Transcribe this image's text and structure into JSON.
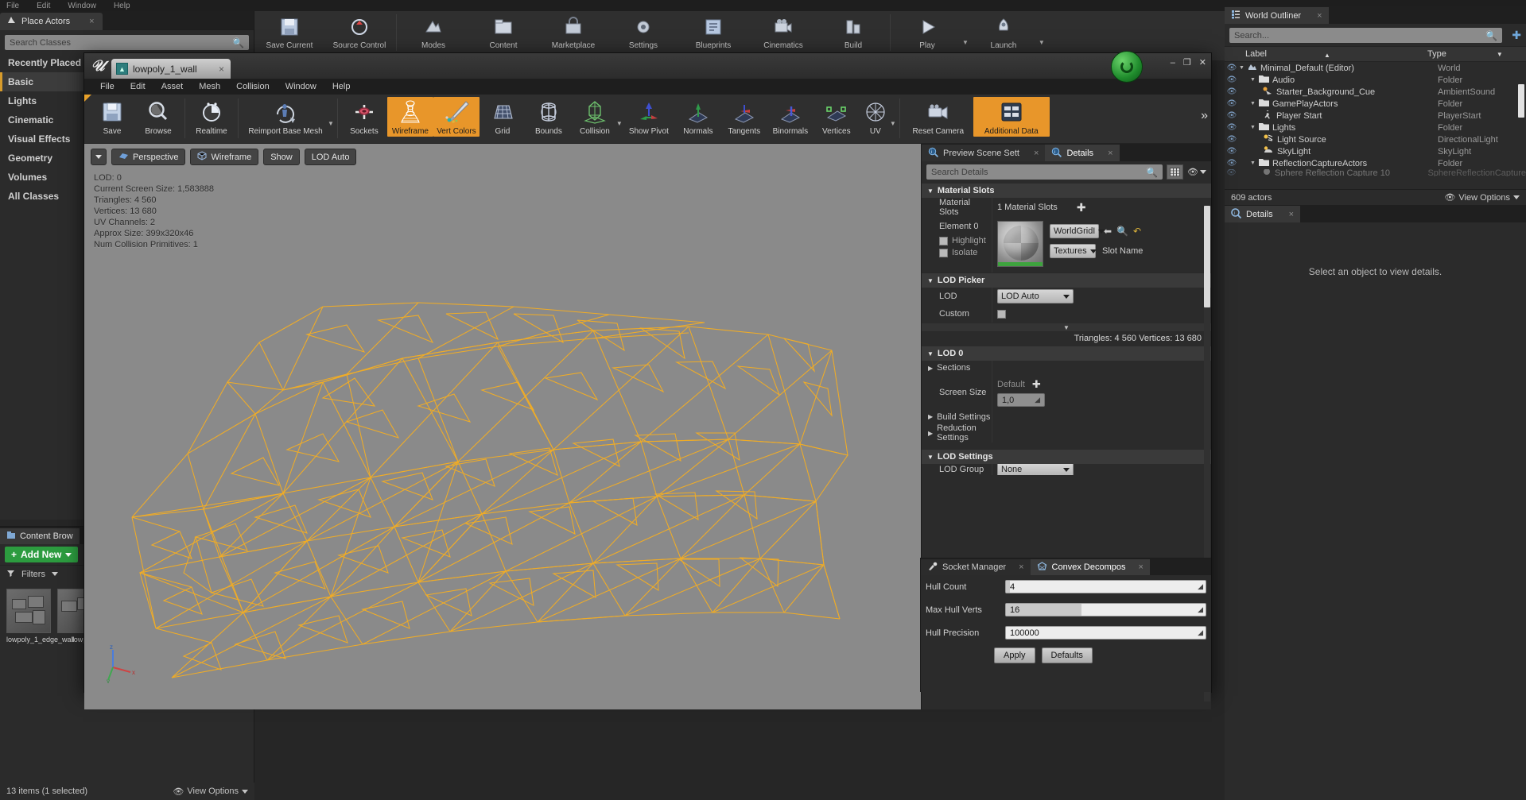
{
  "app": {
    "menubar": [
      "File",
      "Edit",
      "Window",
      "Help"
    ]
  },
  "place_actors": {
    "tab_label": "Place Actors",
    "tab_close": "×",
    "search_placeholder": "Search Classes",
    "categories": [
      {
        "label": "Recently Placed",
        "selected": false
      },
      {
        "label": "Basic",
        "selected": true
      },
      {
        "label": "Lights",
        "selected": false
      },
      {
        "label": "Cinematic",
        "selected": false
      },
      {
        "label": "Visual Effects",
        "selected": false
      },
      {
        "label": "Geometry",
        "selected": false
      },
      {
        "label": "Volumes",
        "selected": false
      },
      {
        "label": "All Classes",
        "selected": false
      }
    ]
  },
  "content_browser": {
    "tab_label": "Content Brow",
    "add_new_label": "Add New",
    "filters_label": "Filters",
    "assets": [
      {
        "name": "lowpoly_1_edge_wall"
      },
      {
        "name": "lowp"
      }
    ],
    "status": "13 items (1 selected)",
    "view_options": "View Options"
  },
  "main_toolbar": {
    "items": [
      {
        "label": "Save Current",
        "icon": "save-icon"
      },
      {
        "label": "Source Control",
        "icon": "source-control-icon"
      },
      {
        "label": "Modes",
        "icon": "modes-icon"
      },
      {
        "label": "Content",
        "icon": "content-icon"
      },
      {
        "label": "Marketplace",
        "icon": "marketplace-icon"
      },
      {
        "label": "Settings",
        "icon": "settings-icon"
      },
      {
        "label": "Blueprints",
        "icon": "blueprints-icon"
      },
      {
        "label": "Cinematics",
        "icon": "cinematics-icon"
      },
      {
        "label": "Build",
        "icon": "build-icon"
      },
      {
        "label": "Play",
        "icon": "play-icon"
      },
      {
        "label": "Launch",
        "icon": "launch-icon"
      }
    ]
  },
  "world_outliner": {
    "tab_label": "World Outliner",
    "tab_close": "×",
    "search_placeholder": "Search...",
    "columns": {
      "label": "Label",
      "type": "Type"
    },
    "rows": [
      {
        "label": "Minimal_Default (Editor)",
        "type": "World",
        "depth": 0,
        "expandable": true,
        "icon": "world-icon"
      },
      {
        "label": "Audio",
        "type": "Folder",
        "depth": 1,
        "expandable": true,
        "icon": "folder-icon"
      },
      {
        "label": "Starter_Background_Cue",
        "type": "AmbientSound",
        "depth": 2,
        "expandable": false,
        "icon": "ambient-sound-icon"
      },
      {
        "label": "GamePlayActors",
        "type": "Folder",
        "depth": 1,
        "expandable": true,
        "icon": "folder-icon"
      },
      {
        "label": "Player Start",
        "type": "PlayerStart",
        "depth": 2,
        "expandable": false,
        "icon": "player-start-icon"
      },
      {
        "label": "Lights",
        "type": "Folder",
        "depth": 1,
        "expandable": true,
        "icon": "folder-icon"
      },
      {
        "label": "Light Source",
        "type": "DirectionalLight",
        "depth": 2,
        "expandable": false,
        "icon": "directional-light-icon"
      },
      {
        "label": "SkyLight",
        "type": "SkyLight",
        "depth": 2,
        "expandable": false,
        "icon": "sky-light-icon"
      },
      {
        "label": "ReflectionCaptureActors",
        "type": "Folder",
        "depth": 1,
        "expandable": true,
        "icon": "folder-icon"
      },
      {
        "label": "Sphere Reflection Capture 10",
        "type": "SphereReflectionCapture",
        "depth": 2,
        "expandable": false,
        "icon": "reflection-capture-icon"
      }
    ],
    "actor_count": "609 actors",
    "view_options": "View Options"
  },
  "details_right": {
    "tab_label": "Details",
    "tab_close": "×",
    "empty_message": "Select an object to view details."
  },
  "mesh_window": {
    "title_tab": "lowpoly_1_wall",
    "tab_close": "×",
    "window_buttons": {
      "minimize": "–",
      "maximize": "❐",
      "close": "✕"
    },
    "menubar": [
      "File",
      "Edit",
      "Asset",
      "Mesh",
      "Collision",
      "Window",
      "Help"
    ],
    "toolbar": [
      {
        "label": "Save",
        "icon": "save-icon",
        "highlighted": false,
        "caret": false
      },
      {
        "label": "Browse",
        "icon": "browse-icon",
        "highlighted": false,
        "caret": false
      },
      {
        "label": "Realtime",
        "icon": "realtime-icon",
        "highlighted": false,
        "caret": false
      },
      {
        "label": "Reimport Base Mesh",
        "icon": "reimport-icon",
        "highlighted": false,
        "caret": true
      },
      {
        "label": "Sockets",
        "icon": "sockets-icon",
        "highlighted": false,
        "caret": false
      },
      {
        "label": "Wireframe",
        "icon": "wireframe-icon",
        "highlighted": true,
        "caret": false
      },
      {
        "label": "Vert Colors",
        "icon": "vert-colors-icon",
        "highlighted": true,
        "caret": false
      },
      {
        "label": "Grid",
        "icon": "grid-icon",
        "highlighted": false,
        "caret": false
      },
      {
        "label": "Bounds",
        "icon": "bounds-icon",
        "highlighted": false,
        "caret": false
      },
      {
        "label": "Collision",
        "icon": "collision-icon",
        "highlighted": false,
        "caret": true
      },
      {
        "label": "Show Pivot",
        "icon": "pivot-icon",
        "highlighted": false,
        "caret": false
      },
      {
        "label": "Normals",
        "icon": "normals-icon",
        "highlighted": false,
        "caret": false
      },
      {
        "label": "Tangents",
        "icon": "tangents-icon",
        "highlighted": false,
        "caret": false
      },
      {
        "label": "Binormals",
        "icon": "binormals-icon",
        "highlighted": false,
        "caret": false
      },
      {
        "label": "Vertices",
        "icon": "vertices-icon",
        "highlighted": false,
        "caret": false
      },
      {
        "label": "UV",
        "icon": "uv-icon",
        "highlighted": false,
        "caret": true
      },
      {
        "label": "Reset Camera",
        "icon": "reset-camera-icon",
        "highlighted": false,
        "caret": false
      },
      {
        "label": "Additional Data",
        "icon": "additional-data-icon",
        "highlighted": true,
        "caret": false
      }
    ],
    "toolbar_overflow": "»",
    "viewport": {
      "view_mode": "Perspective",
      "shading_mode": "Wireframe",
      "show_menu": "Show",
      "lod_menu": "LOD Auto",
      "stats": [
        "LOD: 0",
        "Current Screen Size: 1,583888",
        "Triangles: 4 560",
        "Vertices: 13 680",
        "UV Channels: 2",
        "Approx Size: 399x320x46",
        "Num Collision Primitives: 1"
      ],
      "axis_labels": {
        "x": "x",
        "y": "y",
        "z": "z"
      }
    },
    "details": {
      "tabs": [
        {
          "label": "Preview Scene Sett",
          "active": false,
          "icon": "preview-scene-icon"
        },
        {
          "label": "Details",
          "active": true,
          "icon": "details-icon"
        }
      ],
      "search_placeholder": "Search Details",
      "sections": {
        "material_slots": {
          "title": "Material Slots",
          "row_label": "Material Slots",
          "row_value": "1 Material Slots",
          "add_icon": "plus-icon",
          "element_label": "Element 0",
          "highlight_label": "Highlight",
          "isolate_label": "Isolate",
          "material_name": "WorldGridI",
          "textures_label": "Textures",
          "slot_name_label": "Slot Name"
        },
        "lod_picker": {
          "title": "LOD Picker",
          "lod_label": "LOD",
          "lod_value": "LOD Auto",
          "custom_label": "Custom"
        },
        "lod_0": {
          "title": "LOD 0",
          "tri_verts": "Triangles: 4 560   Vertices: 13 680",
          "sections_label": "Sections",
          "screen_size_label": "Screen Size",
          "default_label": "Default",
          "screen_size_value": "1,0",
          "build_settings_label": "Build Settings",
          "reduction_settings_label": "Reduction Settings"
        },
        "lod_settings": {
          "title": "LOD Settings",
          "lod_group_label": "LOD Group",
          "lod_group_value": "None"
        }
      }
    },
    "bottom_panel": {
      "tabs": [
        {
          "label": "Socket Manager",
          "active": false,
          "icon": "socket-manager-icon"
        },
        {
          "label": "Convex Decompos",
          "active": true,
          "icon": "convex-decomposition-icon"
        }
      ],
      "fields": [
        {
          "label": "Hull Count",
          "value": "4",
          "fill_pct": 2
        },
        {
          "label": "Max Hull Verts",
          "value": "16",
          "fill_pct": 38
        },
        {
          "label": "Hull Precision",
          "value": "100000",
          "fill_pct": 0
        }
      ],
      "apply_label": "Apply",
      "defaults_label": "Defaults"
    }
  },
  "colors": {
    "accent_orange": "#e8962a",
    "wireframe": "#f0a820",
    "viewport_bg": "#8a8a8a",
    "panel_bg": "#2b2b2b",
    "green_button": "#1f8b2c"
  }
}
